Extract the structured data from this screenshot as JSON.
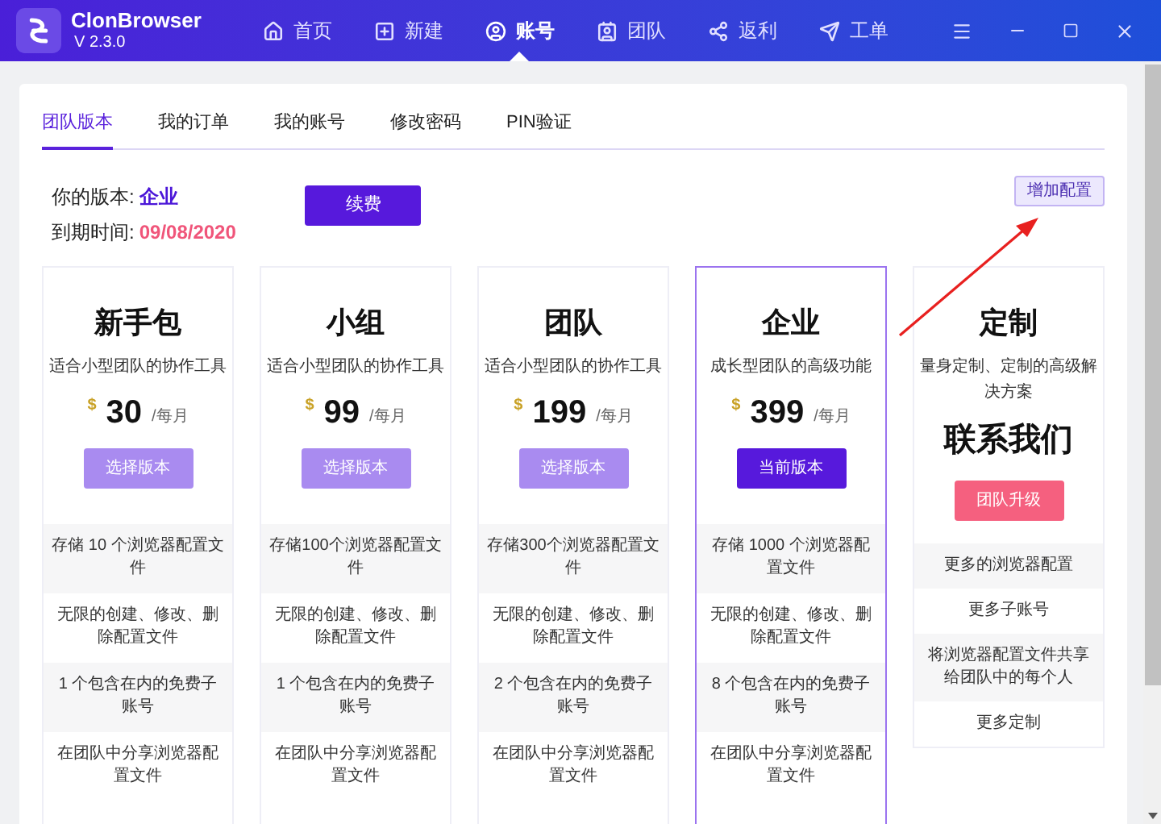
{
  "app": {
    "name": "ClonBrowser",
    "version": "V 2.3.0"
  },
  "nav": [
    {
      "label": "首页",
      "selected": false
    },
    {
      "label": "新建",
      "selected": false
    },
    {
      "label": "账号",
      "selected": true
    },
    {
      "label": "团队",
      "selected": false
    },
    {
      "label": "返利",
      "selected": false
    },
    {
      "label": "工单",
      "selected": false
    }
  ],
  "tabs": [
    {
      "label": "团队版本",
      "selected": true
    },
    {
      "label": "我的订单",
      "selected": false
    },
    {
      "label": "我的账号",
      "selected": false
    },
    {
      "label": "修改密码",
      "selected": false
    },
    {
      "label": "PIN验证",
      "selected": false
    }
  ],
  "account": {
    "version_label": "你的版本:",
    "version": "企业",
    "expiry_label": "到期时间:",
    "expiry": "09/08/2020",
    "renew_button": "续费",
    "add_config_button": "增加配置"
  },
  "plans": [
    {
      "kind": "standard",
      "selected": false,
      "name": "新手包",
      "description": "适合小型团队的协作工具",
      "currency": "$",
      "price": "30",
      "period": "/每月",
      "button": "选择版本",
      "features": [
        "存储 10 个浏览器配置文件",
        "无限的创建、修改、删除配置文件",
        "1 个包含在内的免费子账号",
        "在团队中分享浏览器配置文件"
      ]
    },
    {
      "kind": "standard",
      "selected": false,
      "name": "小组",
      "description": "适合小型团队的协作工具",
      "currency": "$",
      "price": "99",
      "period": "/每月",
      "button": "选择版本",
      "features": [
        "存储100个浏览器配置文件",
        "无限的创建、修改、删除配置文件",
        "1 个包含在内的免费子账号",
        "在团队中分享浏览器配置文件"
      ]
    },
    {
      "kind": "standard",
      "selected": false,
      "name": "团队",
      "description": "适合小型团队的协作工具",
      "currency": "$",
      "price": "199",
      "period": "/每月",
      "button": "选择版本",
      "features": [
        "存储300个浏览器配置文件",
        "无限的创建、修改、删除配置文件",
        "2 个包含在内的免费子账号",
        "在团队中分享浏览器配置文件"
      ]
    },
    {
      "kind": "standard",
      "selected": true,
      "name": "企业",
      "description": "成长型团队的高级功能",
      "currency": "$",
      "price": "399",
      "period": "/每月",
      "button": "当前版本",
      "features": [
        "存储 1000 个浏览器配置文件",
        "无限的创建、修改、删除配置文件",
        "8 个包含在内的免费子账号",
        "在团队中分享浏览器配置文件"
      ]
    },
    {
      "kind": "custom",
      "selected": false,
      "name": "定制",
      "description": "量身定制、定制的高级解决方案",
      "contact": "联系我们",
      "button": "团队升级",
      "features": [
        "更多的浏览器配置",
        "更多子账号",
        "将浏览器配置文件共享给团队中的每个人",
        "更多定制"
      ]
    }
  ]
}
